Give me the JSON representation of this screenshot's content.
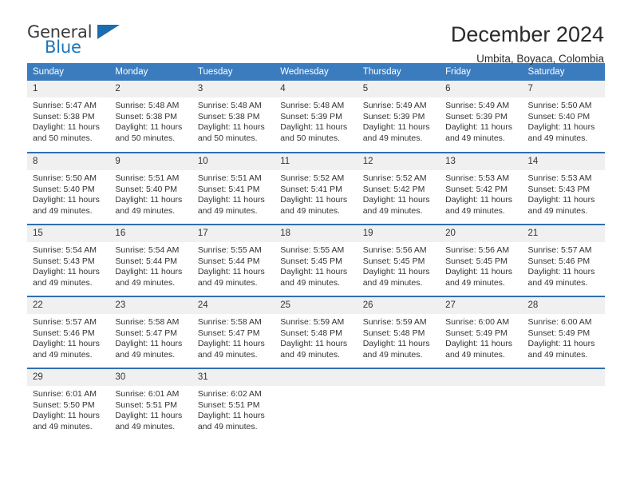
{
  "brand": {
    "name_primary": "General",
    "name_secondary": "Blue",
    "triangle_color": "#1b6cb0",
    "accent_color": "#3b7cbf"
  },
  "header": {
    "month_title": "December 2024",
    "location": "Umbita, Boyaca, Colombia"
  },
  "weekday_headers": [
    "Sunday",
    "Monday",
    "Tuesday",
    "Wednesday",
    "Thursday",
    "Friday",
    "Saturday"
  ],
  "labels": {
    "sunrise_prefix": "Sunrise:",
    "sunset_prefix": "Sunset:",
    "daylight_prefix": "Daylight:"
  },
  "weeks": [
    [
      {
        "day": "1",
        "sunrise": "Sunrise: 5:47 AM",
        "sunset": "Sunset: 5:38 PM",
        "daylight_line1": "Daylight: 11 hours",
        "daylight_line2": "and 50 minutes."
      },
      {
        "day": "2",
        "sunrise": "Sunrise: 5:48 AM",
        "sunset": "Sunset: 5:38 PM",
        "daylight_line1": "Daylight: 11 hours",
        "daylight_line2": "and 50 minutes."
      },
      {
        "day": "3",
        "sunrise": "Sunrise: 5:48 AM",
        "sunset": "Sunset: 5:38 PM",
        "daylight_line1": "Daylight: 11 hours",
        "daylight_line2": "and 50 minutes."
      },
      {
        "day": "4",
        "sunrise": "Sunrise: 5:48 AM",
        "sunset": "Sunset: 5:39 PM",
        "daylight_line1": "Daylight: 11 hours",
        "daylight_line2": "and 50 minutes."
      },
      {
        "day": "5",
        "sunrise": "Sunrise: 5:49 AM",
        "sunset": "Sunset: 5:39 PM",
        "daylight_line1": "Daylight: 11 hours",
        "daylight_line2": "and 49 minutes."
      },
      {
        "day": "6",
        "sunrise": "Sunrise: 5:49 AM",
        "sunset": "Sunset: 5:39 PM",
        "daylight_line1": "Daylight: 11 hours",
        "daylight_line2": "and 49 minutes."
      },
      {
        "day": "7",
        "sunrise": "Sunrise: 5:50 AM",
        "sunset": "Sunset: 5:40 PM",
        "daylight_line1": "Daylight: 11 hours",
        "daylight_line2": "and 49 minutes."
      }
    ],
    [
      {
        "day": "8",
        "sunrise": "Sunrise: 5:50 AM",
        "sunset": "Sunset: 5:40 PM",
        "daylight_line1": "Daylight: 11 hours",
        "daylight_line2": "and 49 minutes."
      },
      {
        "day": "9",
        "sunrise": "Sunrise: 5:51 AM",
        "sunset": "Sunset: 5:40 PM",
        "daylight_line1": "Daylight: 11 hours",
        "daylight_line2": "and 49 minutes."
      },
      {
        "day": "10",
        "sunrise": "Sunrise: 5:51 AM",
        "sunset": "Sunset: 5:41 PM",
        "daylight_line1": "Daylight: 11 hours",
        "daylight_line2": "and 49 minutes."
      },
      {
        "day": "11",
        "sunrise": "Sunrise: 5:52 AM",
        "sunset": "Sunset: 5:41 PM",
        "daylight_line1": "Daylight: 11 hours",
        "daylight_line2": "and 49 minutes."
      },
      {
        "day": "12",
        "sunrise": "Sunrise: 5:52 AM",
        "sunset": "Sunset: 5:42 PM",
        "daylight_line1": "Daylight: 11 hours",
        "daylight_line2": "and 49 minutes."
      },
      {
        "day": "13",
        "sunrise": "Sunrise: 5:53 AM",
        "sunset": "Sunset: 5:42 PM",
        "daylight_line1": "Daylight: 11 hours",
        "daylight_line2": "and 49 minutes."
      },
      {
        "day": "14",
        "sunrise": "Sunrise: 5:53 AM",
        "sunset": "Sunset: 5:43 PM",
        "daylight_line1": "Daylight: 11 hours",
        "daylight_line2": "and 49 minutes."
      }
    ],
    [
      {
        "day": "15",
        "sunrise": "Sunrise: 5:54 AM",
        "sunset": "Sunset: 5:43 PM",
        "daylight_line1": "Daylight: 11 hours",
        "daylight_line2": "and 49 minutes."
      },
      {
        "day": "16",
        "sunrise": "Sunrise: 5:54 AM",
        "sunset": "Sunset: 5:44 PM",
        "daylight_line1": "Daylight: 11 hours",
        "daylight_line2": "and 49 minutes."
      },
      {
        "day": "17",
        "sunrise": "Sunrise: 5:55 AM",
        "sunset": "Sunset: 5:44 PM",
        "daylight_line1": "Daylight: 11 hours",
        "daylight_line2": "and 49 minutes."
      },
      {
        "day": "18",
        "sunrise": "Sunrise: 5:55 AM",
        "sunset": "Sunset: 5:45 PM",
        "daylight_line1": "Daylight: 11 hours",
        "daylight_line2": "and 49 minutes."
      },
      {
        "day": "19",
        "sunrise": "Sunrise: 5:56 AM",
        "sunset": "Sunset: 5:45 PM",
        "daylight_line1": "Daylight: 11 hours",
        "daylight_line2": "and 49 minutes."
      },
      {
        "day": "20",
        "sunrise": "Sunrise: 5:56 AM",
        "sunset": "Sunset: 5:45 PM",
        "daylight_line1": "Daylight: 11 hours",
        "daylight_line2": "and 49 minutes."
      },
      {
        "day": "21",
        "sunrise": "Sunrise: 5:57 AM",
        "sunset": "Sunset: 5:46 PM",
        "daylight_line1": "Daylight: 11 hours",
        "daylight_line2": "and 49 minutes."
      }
    ],
    [
      {
        "day": "22",
        "sunrise": "Sunrise: 5:57 AM",
        "sunset": "Sunset: 5:46 PM",
        "daylight_line1": "Daylight: 11 hours",
        "daylight_line2": "and 49 minutes."
      },
      {
        "day": "23",
        "sunrise": "Sunrise: 5:58 AM",
        "sunset": "Sunset: 5:47 PM",
        "daylight_line1": "Daylight: 11 hours",
        "daylight_line2": "and 49 minutes."
      },
      {
        "day": "24",
        "sunrise": "Sunrise: 5:58 AM",
        "sunset": "Sunset: 5:47 PM",
        "daylight_line1": "Daylight: 11 hours",
        "daylight_line2": "and 49 minutes."
      },
      {
        "day": "25",
        "sunrise": "Sunrise: 5:59 AM",
        "sunset": "Sunset: 5:48 PM",
        "daylight_line1": "Daylight: 11 hours",
        "daylight_line2": "and 49 minutes."
      },
      {
        "day": "26",
        "sunrise": "Sunrise: 5:59 AM",
        "sunset": "Sunset: 5:48 PM",
        "daylight_line1": "Daylight: 11 hours",
        "daylight_line2": "and 49 minutes."
      },
      {
        "day": "27",
        "sunrise": "Sunrise: 6:00 AM",
        "sunset": "Sunset: 5:49 PM",
        "daylight_line1": "Daylight: 11 hours",
        "daylight_line2": "and 49 minutes."
      },
      {
        "day": "28",
        "sunrise": "Sunrise: 6:00 AM",
        "sunset": "Sunset: 5:49 PM",
        "daylight_line1": "Daylight: 11 hours",
        "daylight_line2": "and 49 minutes."
      }
    ],
    [
      {
        "day": "29",
        "sunrise": "Sunrise: 6:01 AM",
        "sunset": "Sunset: 5:50 PM",
        "daylight_line1": "Daylight: 11 hours",
        "daylight_line2": "and 49 minutes."
      },
      {
        "day": "30",
        "sunrise": "Sunrise: 6:01 AM",
        "sunset": "Sunset: 5:51 PM",
        "daylight_line1": "Daylight: 11 hours",
        "daylight_line2": "and 49 minutes."
      },
      {
        "day": "31",
        "sunrise": "Sunrise: 6:02 AM",
        "sunset": "Sunset: 5:51 PM",
        "daylight_line1": "Daylight: 11 hours",
        "daylight_line2": "and 49 minutes."
      },
      {
        "day": "",
        "sunrise": "",
        "sunset": "",
        "daylight_line1": "",
        "daylight_line2": ""
      },
      {
        "day": "",
        "sunrise": "",
        "sunset": "",
        "daylight_line1": "",
        "daylight_line2": ""
      },
      {
        "day": "",
        "sunrise": "",
        "sunset": "",
        "daylight_line1": "",
        "daylight_line2": ""
      },
      {
        "day": "",
        "sunrise": "",
        "sunset": "",
        "daylight_line1": "",
        "daylight_line2": ""
      }
    ]
  ]
}
